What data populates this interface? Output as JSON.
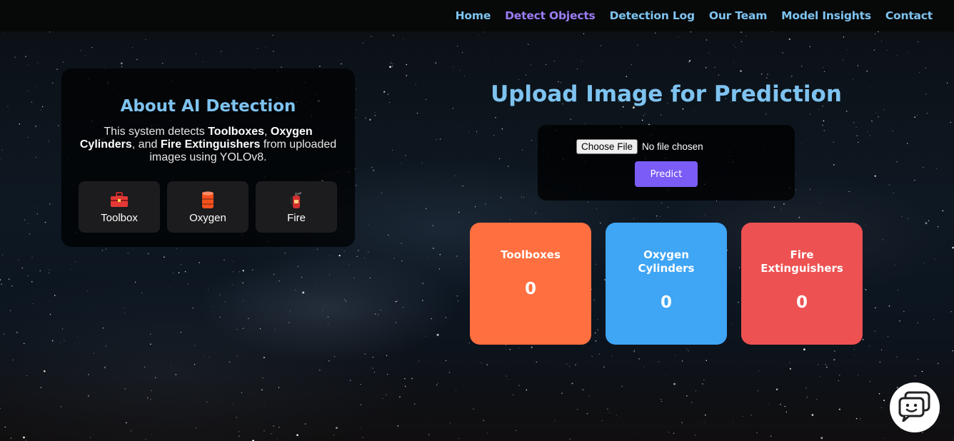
{
  "nav": {
    "items": [
      {
        "label": "Home"
      },
      {
        "label": "Detect Objects",
        "active": true
      },
      {
        "label": "Detection Log"
      },
      {
        "label": "Our Team"
      },
      {
        "label": "Model Insights"
      },
      {
        "label": "Contact"
      }
    ],
    "link_color": "#7ec3f0",
    "active_color": "#9b7df5"
  },
  "about": {
    "title": "About AI Detection",
    "desc_prefix": "This system detects ",
    "item1": "Toolboxes",
    "sep1": ", ",
    "item2": "Oxygen Cylinders",
    "sep2": ", and ",
    "item3": "Fire Extinguishers",
    "desc_suffix": " from uploaded images using YOLOv8.",
    "features": [
      {
        "icon": "toolbox-icon",
        "label": "Toolbox"
      },
      {
        "icon": "oxygen-cylinder-icon",
        "label": "Oxygen"
      },
      {
        "icon": "fire-extinguisher-icon",
        "label": "Fire"
      }
    ]
  },
  "upload": {
    "title": "Upload Image for Prediction",
    "choose_label": "Choose File",
    "file_status": "No file chosen",
    "predict_label": "Predict",
    "predict_color": "#7b5cf6"
  },
  "counts": {
    "toolboxes": {
      "label": "Toolboxes",
      "value": "0",
      "color": "#ff6f3f"
    },
    "oxygen": {
      "label": "Oxygen Cylinders",
      "value": "0",
      "color": "#3fa5f5"
    },
    "fire": {
      "label": "Fire Extinguishers",
      "value": "0",
      "color": "#ee5151"
    }
  },
  "chat": {
    "icon": "chat-bot-icon"
  }
}
